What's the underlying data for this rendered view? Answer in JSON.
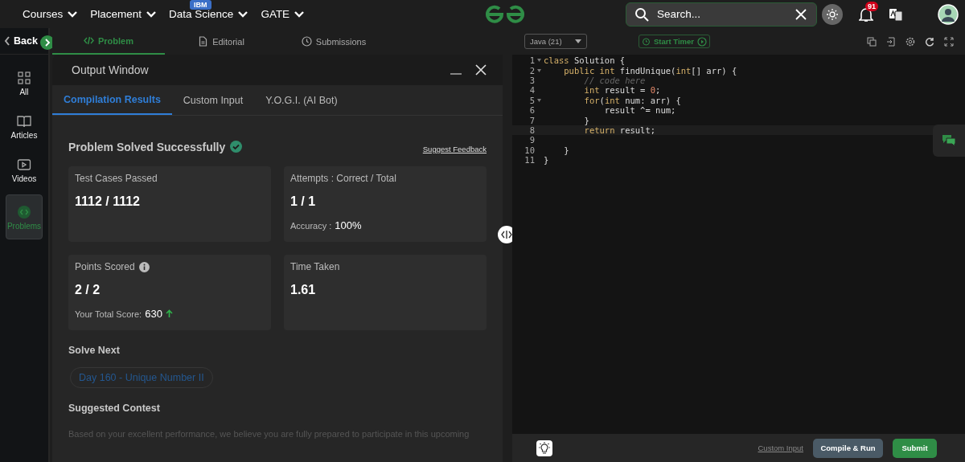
{
  "nav": {
    "menus": [
      {
        "label": "Courses"
      },
      {
        "label": "Placement"
      },
      {
        "label": "Data Science",
        "badge": "IBM"
      },
      {
        "label": "GATE"
      }
    ],
    "search": {
      "placeholder": "Search..."
    },
    "notifications": "91"
  },
  "back": "Back",
  "rail": [
    {
      "label": "All",
      "selected": false
    },
    {
      "label": "Articles",
      "selected": false
    },
    {
      "label": "Videos",
      "selected": false
    },
    {
      "label": "Problems",
      "selected": true
    }
  ],
  "tabs": [
    {
      "label": "Problem",
      "selected": true
    },
    {
      "label": "Editorial",
      "selected": false
    },
    {
      "label": "Submissions",
      "selected": false
    }
  ],
  "output": {
    "title": "Output Window",
    "tabs": [
      {
        "label": "Compilation Results",
        "selected": true
      },
      {
        "label": "Custom Input",
        "selected": false
      },
      {
        "label": "Y.O.G.I. (AI Bot)",
        "selected": false
      }
    ],
    "status": "Problem Solved Successfully",
    "feedback": "Suggest Feedback",
    "cards": [
      {
        "label": "Test Cases Passed",
        "value": "1112 / 1112"
      },
      {
        "label": "Attempts : Correct / Total",
        "value": "1 / 1",
        "sub_label": "Accuracy :",
        "sub_value": "100%"
      },
      {
        "label": "Points Scored",
        "info": true,
        "value": "2 / 2",
        "sub_label": "Your Total Score:",
        "sub_value": "630",
        "trend_up": true
      },
      {
        "label": "Time Taken",
        "value": "1.61"
      }
    ],
    "solve_next": {
      "heading": "Solve Next",
      "link": "Day 160 - Unique Number II"
    },
    "contest": {
      "heading": "Suggested Contest",
      "text": "Based on your excellent performance, we believe you are fully prepared to participate in this upcoming"
    }
  },
  "editor": {
    "language": "Java (21)",
    "timer": "Start Timer",
    "lines": [
      {
        "number": "1",
        "fold": true,
        "active": false,
        "tokens": [
          {
            "kind": "keyword",
            "text": "class"
          },
          {
            "kind": "plain",
            "text": " Solution {"
          }
        ]
      },
      {
        "number": "2",
        "fold": true,
        "active": false,
        "tokens": [
          {
            "kind": "keyword",
            "text": "    public"
          },
          {
            "kind": "keyword",
            "text": " int"
          },
          {
            "kind": "plain",
            "text": " findUnique("
          },
          {
            "kind": "keyword",
            "text": "int"
          },
          {
            "kind": "plain",
            "text": "[] arr) {"
          }
        ]
      },
      {
        "number": "3",
        "fold": false,
        "active": false,
        "tokens": [
          {
            "kind": "comment",
            "text": "        // code here"
          }
        ]
      },
      {
        "number": "4",
        "fold": false,
        "active": false,
        "tokens": [
          {
            "kind": "keyword",
            "text": "        int"
          },
          {
            "kind": "plain",
            "text": " result = "
          },
          {
            "kind": "number",
            "text": "0"
          },
          {
            "kind": "plain",
            "text": ";"
          }
        ]
      },
      {
        "number": "5",
        "fold": true,
        "active": false,
        "tokens": [
          {
            "kind": "keyword",
            "text": "        for"
          },
          {
            "kind": "plain",
            "text": "("
          },
          {
            "kind": "keyword",
            "text": "int"
          },
          {
            "kind": "plain",
            "text": " num: arr) {"
          }
        ]
      },
      {
        "number": "6",
        "fold": false,
        "active": false,
        "tokens": [
          {
            "kind": "plain",
            "text": "            result ^= num;"
          }
        ]
      },
      {
        "number": "7",
        "fold": false,
        "active": false,
        "tokens": [
          {
            "kind": "plain",
            "text": "        }"
          }
        ]
      },
      {
        "number": "8",
        "fold": false,
        "active": true,
        "tokens": [
          {
            "kind": "keyword",
            "text": "        return"
          },
          {
            "kind": "plain",
            "text": " result;"
          }
        ]
      },
      {
        "number": "9",
        "fold": false,
        "active": false
      },
      {
        "number": "10",
        "fold": false,
        "active": false,
        "tokens": [
          {
            "kind": "plain",
            "text": "    }"
          }
        ]
      },
      {
        "number": "11",
        "fold": false,
        "active": false,
        "tokens": [
          {
            "kind": "plain",
            "text": "}"
          }
        ]
      }
    ],
    "custom_input": "Custom Input",
    "compile": "Compile & Run",
    "submit": "Submit"
  }
}
